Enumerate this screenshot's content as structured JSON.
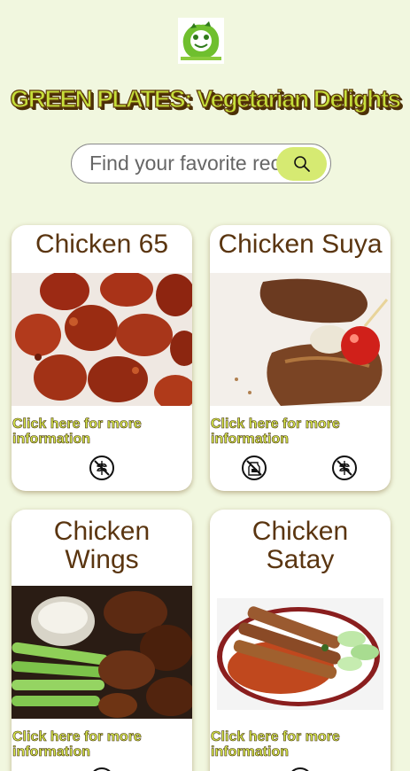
{
  "header": {
    "logo_icon": "loving-vegan-logo",
    "title": "GREEN PLATES: Vegetarian Delights"
  },
  "search": {
    "placeholder": "Find your favorite recipe...",
    "button_icon": "search-icon"
  },
  "cards": [
    {
      "title": "Chicken 65",
      "link_text": "Click here for more information",
      "icons": [
        "gluten-free-icon"
      ]
    },
    {
      "title": "Chicken Suya",
      "link_text": "Click here for more information",
      "icons": [
        "dairy-free-icon",
        "gluten-free-icon"
      ]
    },
    {
      "title": "Chicken Wings",
      "link_text": "Click here for more information",
      "icons": [
        "gluten-free-icon"
      ]
    },
    {
      "title": "Chicken Satay",
      "link_text": "Click here for more information",
      "icons": [
        "gluten-free-icon"
      ]
    }
  ],
  "colors": {
    "page_background": "#f1f7df",
    "title_fill": "#c6df3a",
    "title_outline": "#5e3b0a",
    "card_title": "#5a3510",
    "search_button": "#d6ea72",
    "link_text": "#d9ea4c"
  }
}
